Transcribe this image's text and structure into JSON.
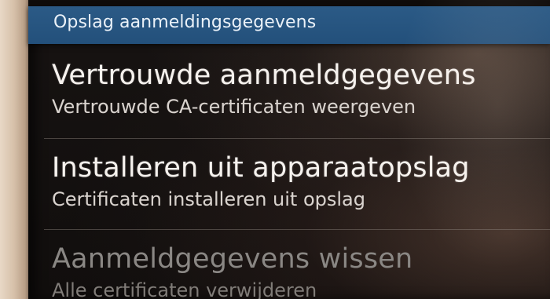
{
  "header": {
    "title": "Opslag aanmeldingsgegevens"
  },
  "items": [
    {
      "title": "Vertrouwde aanmeldgegevens",
      "subtitle": "Vertrouwde CA-certificaten weergeven",
      "enabled": true
    },
    {
      "title": "Installeren uit apparaatopslag",
      "subtitle": "Certificaten installeren uit opslag",
      "enabled": true
    },
    {
      "title": "Aanmeldgegevens wissen",
      "subtitle": "Alle certificaten verwijderen",
      "enabled": false
    }
  ],
  "colors": {
    "header_background": "#23507b",
    "screen_background": "#141110",
    "title_text": "#f6f2ee",
    "disabled_text": "#8a8784"
  }
}
